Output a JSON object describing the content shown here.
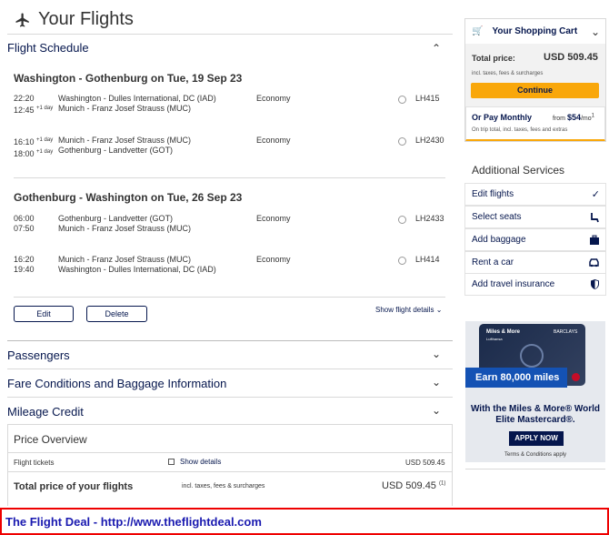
{
  "header": {
    "title": "Your Flights"
  },
  "schedule": {
    "heading": "Flight Schedule",
    "outbound": {
      "title": "Washington - Gothenburg on Tue, 19 Sep 23",
      "legs": [
        {
          "dep_time": "22:20",
          "arr_time": "12:45",
          "arr_offset": "+1 day",
          "dep_offset": "",
          "from": "Washington - Dulles International, DC (IAD)",
          "to": "Munich - Franz Josef Strauss (MUC)",
          "cabin": "Economy",
          "flight": "LH415"
        },
        {
          "dep_time": "16:10",
          "dep_offset": "+1 day",
          "arr_time": "18:00",
          "arr_offset": "+1 day",
          "from": "Munich - Franz Josef Strauss (MUC)",
          "to": "Gothenburg - Landvetter (GOT)",
          "cabin": "Economy",
          "flight": "LH2430"
        }
      ]
    },
    "inbound": {
      "title": "Gothenburg - Washington on Tue, 26 Sep 23",
      "legs": [
        {
          "dep_time": "06:00",
          "arr_time": "07:50",
          "from": "Gothenburg - Landvetter (GOT)",
          "to": "Munich - Franz Josef Strauss (MUC)",
          "cabin": "Economy",
          "flight": "LH2433"
        },
        {
          "dep_time": "16:20",
          "arr_time": "19:40",
          "from": "Munich - Franz Josef Strauss (MUC)",
          "to": "Washington - Dulles International, DC (IAD)",
          "cabin": "Economy",
          "flight": "LH414"
        }
      ]
    },
    "edit_label": "Edit",
    "delete_label": "Delete",
    "show_details": "Show flight details"
  },
  "sections": {
    "passengers": "Passengers",
    "fare": "Fare Conditions and Baggage Information",
    "mileage": "Mileage Credit"
  },
  "price": {
    "heading": "Price Overview",
    "tickets_label": "Flight tickets",
    "show_details": "Show details",
    "tickets_value": "USD 509.45",
    "total_label": "Total price of your flights",
    "total_note": "incl. taxes, fees & surcharges",
    "total_value": "USD 509.45",
    "total_ref": "(1)"
  },
  "cart": {
    "title": "Your Shopping Cart",
    "total_label": "Total price:",
    "total_value": "USD 509.45",
    "total_note": "incl. taxes, fees & surcharges",
    "continue": "Continue",
    "monthly_label": "Or Pay Monthly",
    "monthly_from": "from",
    "monthly_amount": "$54",
    "monthly_unit": "/mo",
    "monthly_ref": "1",
    "monthly_note": "On trip total, incl. taxes, fees and extras"
  },
  "services": {
    "heading": "Additional Services",
    "items": [
      {
        "label": "Edit flights",
        "icon": "check-icon"
      },
      {
        "label": "Select seats",
        "icon": "seat-icon"
      },
      {
        "label": "Add baggage",
        "icon": "baggage-icon"
      },
      {
        "label": "Rent a car",
        "icon": "car-icon"
      },
      {
        "label": "Add travel insurance",
        "icon": "shield-icon"
      }
    ]
  },
  "ad": {
    "card_brand": "Miles & More",
    "card_sub": "Lufthansa",
    "bank": "BARCLAYS",
    "earn": "Earn 80,000 miles",
    "headline": "With the Miles & More® World Elite Mastercard®.",
    "cta": "APPLY NOW",
    "terms": "Terms & Conditions apply"
  },
  "footer": {
    "text": "The Flight Deal - http://www.theflightdeal.com"
  },
  "colors": {
    "accent": "#f9a70a",
    "navy": "#05164d",
    "ad_blue": "#1452b4",
    "banner_red": "#e00000",
    "banner_text": "#1a1ab0"
  }
}
